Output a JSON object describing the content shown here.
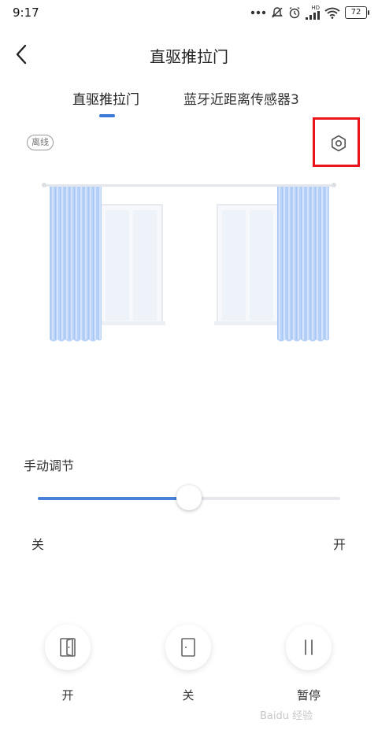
{
  "status_bar": {
    "time": "9:17",
    "battery": "72",
    "network_tag": "HD"
  },
  "header": {
    "title": "直驱推拉门",
    "back_icon": "chevron-left-icon"
  },
  "tabs": [
    {
      "label": "直驱推拉门",
      "active": true
    },
    {
      "label": "蓝牙近距离传感器3",
      "active": false
    }
  ],
  "device": {
    "status_badge": "离线",
    "settings_icon": "gear-icon"
  },
  "manual": {
    "label": "手动调节",
    "min_label": "关",
    "max_label": "开",
    "position": 0.5
  },
  "controls": [
    {
      "label": "开",
      "icon": "door-open-icon"
    },
    {
      "label": "关",
      "icon": "door-closed-icon"
    },
    {
      "label": "暂停",
      "icon": "pause-icon"
    }
  ],
  "watermark": "Baidu 经验",
  "colors": {
    "accent": "#4a80d9",
    "highlight": "#e8141c",
    "curtain": "#b9d3f8"
  }
}
